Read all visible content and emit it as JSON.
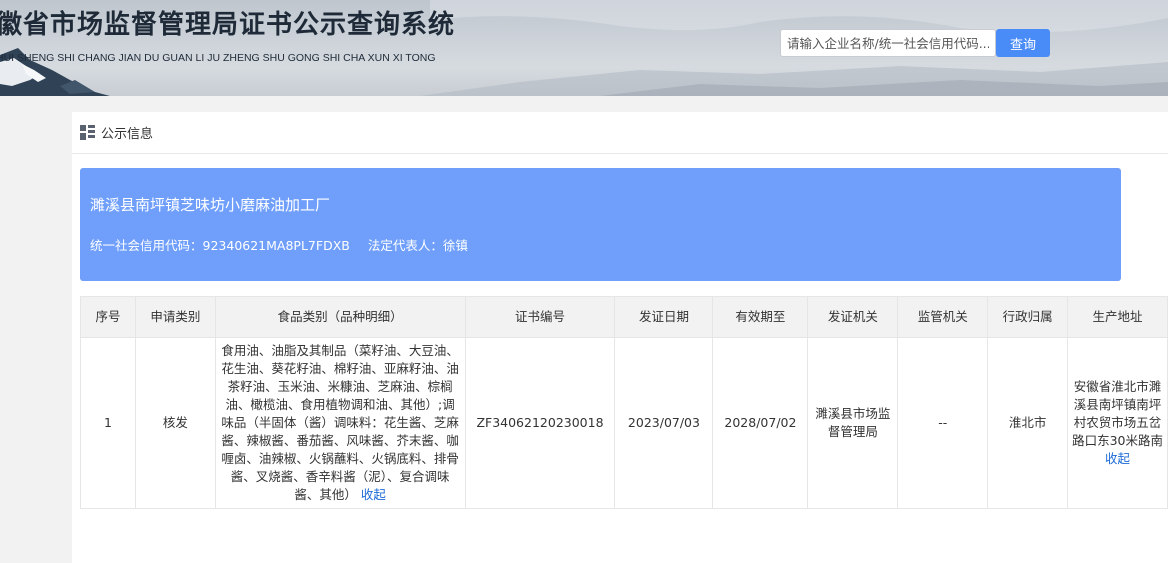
{
  "header": {
    "title": "徽省市场监督管理局证书公示查询系统",
    "subtitle": "HUI SHENG SHI CHANG JIAN DU GUAN LI JU ZHENG SHU GONG SHI CHA XUN XI TONG",
    "search_placeholder": "请输入企业名称/统一社会信用代码...",
    "search_button": "查询"
  },
  "section": {
    "label": "公示信息"
  },
  "company": {
    "name": "濉溪县南坪镇芝味坊小磨麻油加工厂",
    "credit_code_label": "统一社会信用代码：",
    "credit_code": "92340621MA8PL7FDXB",
    "legal_rep_label": "法定代表人：",
    "legal_rep": "徐镇"
  },
  "table": {
    "headers": [
      "序号",
      "申请类别",
      "食品类别（品种明细）",
      "证书编号",
      "发证日期",
      "有效期至",
      "发证机关",
      "监管机关",
      "行政归属",
      "生产地址"
    ],
    "rows": [
      {
        "index": "1",
        "apply_type": "核发",
        "food_category": "食用油、油脂及其制品（菜籽油、大豆油、花生油、葵花籽油、棉籽油、亚麻籽油、油茶籽油、玉米油、米糠油、芝麻油、棕榈油、橄榄油、食用植物调和油、其他）;调味品（半固体（酱）调味料：花生酱、芝麻酱、辣椒酱、番茄酱、风味酱、芥末酱、咖喱卤、油辣椒、火锅蘸料、火锅底料、排骨酱、叉烧酱、香辛料酱（泥）、复合调味酱、其他）",
        "cert_no": "ZF34062120230018",
        "issue_date": "2023/07/03",
        "valid_until": "2028/07/02",
        "issuer": "濉溪县市场监督管理局",
        "supervisor": "--",
        "admin_area": "淮北市",
        "address": "安徽省淮北市濉溪县南坪镇南坪村农贸市场五岔路口东30米路南",
        "collapse_label": "收起"
      }
    ]
  }
}
